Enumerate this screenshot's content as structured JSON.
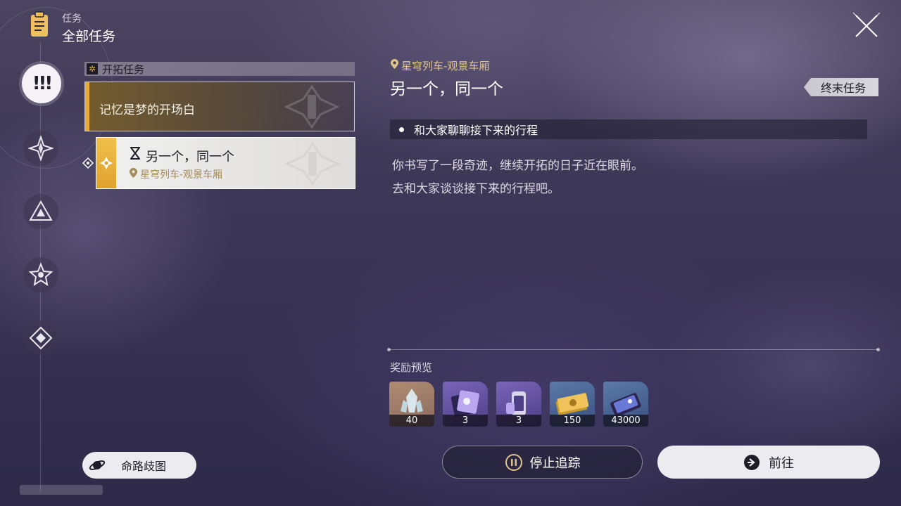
{
  "header": {
    "category": "任务",
    "title": "全部任务"
  },
  "rail": {
    "active_label": "!!!"
  },
  "quest_group": {
    "label": "开拓任务",
    "quests": [
      {
        "title": "记忆是梦的开场白"
      },
      {
        "title": "另一个，同一个",
        "location": "星穹列车-观景车厢"
      }
    ]
  },
  "detail": {
    "location": "星穹列车-观景车厢",
    "title": "另一个，同一个",
    "badge": "终末任务",
    "objective": "和大家聊聊接下来的行程",
    "description_lines": [
      "你书写了一段奇迹，继续开拓的日子近在眼前。",
      "去和大家谈谈接下来的行程吧。"
    ]
  },
  "rewards": {
    "label": "奖励预览",
    "items": [
      {
        "icon": "stellar-jade-icon",
        "count": "40"
      },
      {
        "icon": "travelers-guide-icon",
        "count": "3"
      },
      {
        "icon": "refined-aether-icon",
        "count": "3"
      },
      {
        "icon": "credits-icon",
        "count": "150"
      },
      {
        "icon": "trailblaze-exp-icon",
        "count": "43000"
      }
    ]
  },
  "buttons": {
    "path_map": "命路歧图",
    "stop_tracking": "停止追踪",
    "go": "前往"
  },
  "colors": {
    "accent_gold": "#e9ac3c",
    "location_gold": "#e0c48c"
  }
}
